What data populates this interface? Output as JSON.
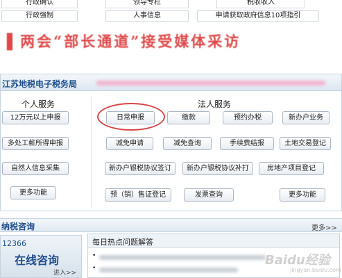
{
  "top_links": {
    "row1": [
      "行政确认",
      "领导专栏",
      "税收收入"
    ],
    "row2": [
      "行政强制",
      "人事信息",
      "申请获取政府信息10项指引"
    ]
  },
  "banner": {
    "text": "▌两会“部长通道”接受媒体采访"
  },
  "tax_panel": {
    "title": "江苏地税电子税务局",
    "personal": {
      "heading": "个人服务",
      "buttons": [
        "12万元以上申报",
        "多处工薪所得申报",
        "自然人信息采集",
        "更多功能"
      ]
    },
    "legal": {
      "heading": "法人服务",
      "buttons": [
        [
          "日常申报",
          "缴款",
          "预约办税",
          "新办户业务"
        ],
        [
          "减免申请",
          "减免查询",
          "手续费结报",
          "土地交易登记"
        ],
        [
          "新办户银税协议签订",
          "新办户银税协议补打",
          "房地产项目登记"
        ],
        [
          "预（销）售证登记",
          "发票查询",
          "更多功能"
        ]
      ]
    }
  },
  "consult": {
    "title": "纳税咨询",
    "more": "更多>>",
    "hotline": "12366",
    "online": "在线咨询",
    "enter": "进入>>",
    "faq_title": "每日热点问题解答",
    "faq_items": [
      "•",
      "•"
    ]
  },
  "watermark": {
    "main": "Baidu经验",
    "sub": "jingyan.baidu.com"
  },
  "colors": {
    "banner_red": "#e04848",
    "title_blue": "#1f4e8c",
    "highlight_circle": "#d84545"
  }
}
